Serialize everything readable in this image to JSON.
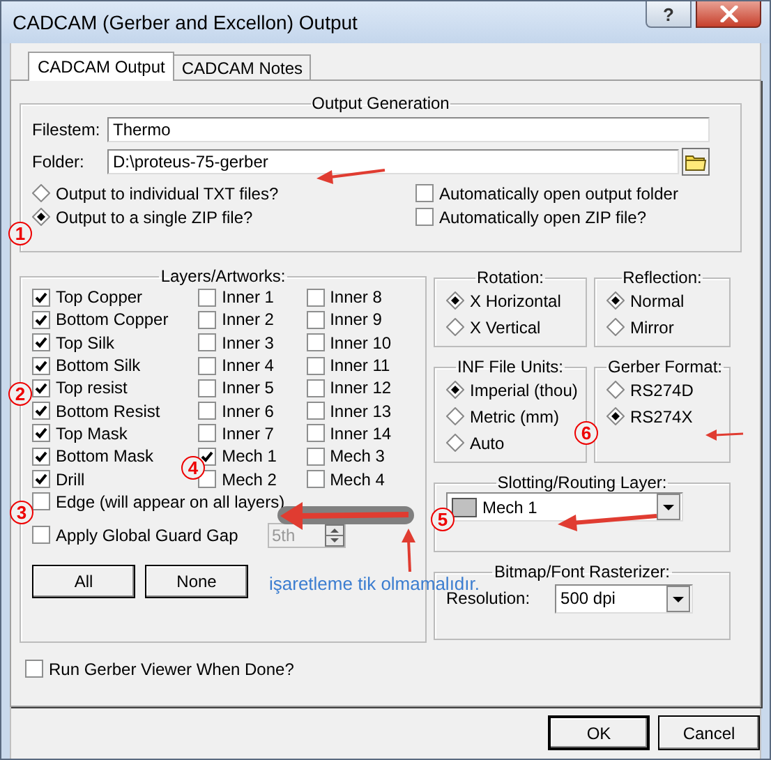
{
  "window": {
    "title": "CADCAM (Gerber and Excellon) Output",
    "help": "?"
  },
  "tabs": [
    {
      "label": "CADCAM Output",
      "selected": true
    },
    {
      "label": "CADCAM Notes",
      "selected": false
    }
  ],
  "output_generation": {
    "title": "Output Generation",
    "filestem": {
      "label": "Filestem:",
      "value": "Thermo"
    },
    "folder": {
      "label": "Folder:",
      "value": "D:\\proteus-75-gerber"
    },
    "output_mode": [
      {
        "label": "Output to individual TXT files?",
        "selected": false
      },
      {
        "label": "Output to a single ZIP file?",
        "selected": true
      }
    ],
    "options": [
      {
        "label": "Automatically open output folder",
        "checked": false
      },
      {
        "label": "Automatically open ZIP file?",
        "checked": false
      }
    ]
  },
  "layers": {
    "title": "Layers/Artworks:",
    "columns": [
      {
        "items": [
          {
            "label": "Top Copper",
            "checked": true
          },
          {
            "label": "Bottom Copper",
            "checked": true
          },
          {
            "label": "Top Silk",
            "checked": true
          },
          {
            "label": "Bottom Silk",
            "checked": true
          },
          {
            "label": "Top resist",
            "checked": true
          },
          {
            "label": "Bottom Resist",
            "checked": true
          },
          {
            "label": "Top Mask",
            "checked": true
          },
          {
            "label": "Bottom Mask",
            "checked": true
          },
          {
            "label": "Drill",
            "checked": true
          }
        ]
      },
      {
        "items": [
          {
            "label": "Inner 1",
            "checked": false
          },
          {
            "label": "Inner 2",
            "checked": false
          },
          {
            "label": "Inner 3",
            "checked": false
          },
          {
            "label": "Inner 4",
            "checked": false
          },
          {
            "label": "Inner 5",
            "checked": false
          },
          {
            "label": "Inner 6",
            "checked": false
          },
          {
            "label": "Inner 7",
            "checked": false
          },
          {
            "label": "Mech 1",
            "checked": true
          },
          {
            "label": "Mech 2",
            "checked": false
          }
        ]
      },
      {
        "items": [
          {
            "label": "Inner 8",
            "checked": false
          },
          {
            "label": "Inner 9",
            "checked": false
          },
          {
            "label": "Inner 10",
            "checked": false
          },
          {
            "label": "Inner 11",
            "checked": false
          },
          {
            "label": "Inner 12",
            "checked": false
          },
          {
            "label": "Inner 13",
            "checked": false
          },
          {
            "label": "Inner 14",
            "checked": false
          },
          {
            "label": "Mech 3",
            "checked": false
          },
          {
            "label": "Mech 4",
            "checked": false
          }
        ]
      }
    ],
    "edge": {
      "label": "Edge (will appear on all layers)",
      "checked": false
    },
    "guard_gap": {
      "label": "Apply Global Guard Gap",
      "checked": false,
      "value": "5th",
      "disabled": true
    },
    "buttons": [
      "All",
      "None"
    ]
  },
  "rotation": {
    "title": "Rotation:",
    "options": [
      {
        "label": "X Horizontal",
        "selected": true
      },
      {
        "label": "X Vertical",
        "selected": false
      }
    ]
  },
  "reflection": {
    "title": "Reflection:",
    "options": [
      {
        "label": "Normal",
        "selected": true
      },
      {
        "label": "Mirror",
        "selected": false
      }
    ]
  },
  "inf_units": {
    "title": "INF File Units:",
    "options": [
      {
        "label": "Imperial (thou)",
        "selected": true
      },
      {
        "label": "Metric (mm)",
        "selected": false
      },
      {
        "label": "Auto",
        "selected": false
      }
    ]
  },
  "gerber_format": {
    "title": "Gerber Format:",
    "options": [
      {
        "label": "RS274D",
        "selected": false
      },
      {
        "label": "RS274X",
        "selected": true
      }
    ]
  },
  "slotting": {
    "title": "Slotting/Routing Layer:",
    "value": "Mech 1"
  },
  "bitmap": {
    "title": "Bitmap/Font Rasterizer:",
    "label": "Resolution:",
    "value": "500 dpi"
  },
  "run_viewer": {
    "label": "Run Gerber Viewer When Done?",
    "checked": false
  },
  "buttons": [
    {
      "label": "OK",
      "default": true
    },
    {
      "label": "Cancel",
      "default": false
    }
  ],
  "annotations": {
    "markers": [
      "1",
      "2",
      "3",
      "4",
      "5",
      "6"
    ],
    "note": "işaretleme tik olmamalıdır."
  }
}
